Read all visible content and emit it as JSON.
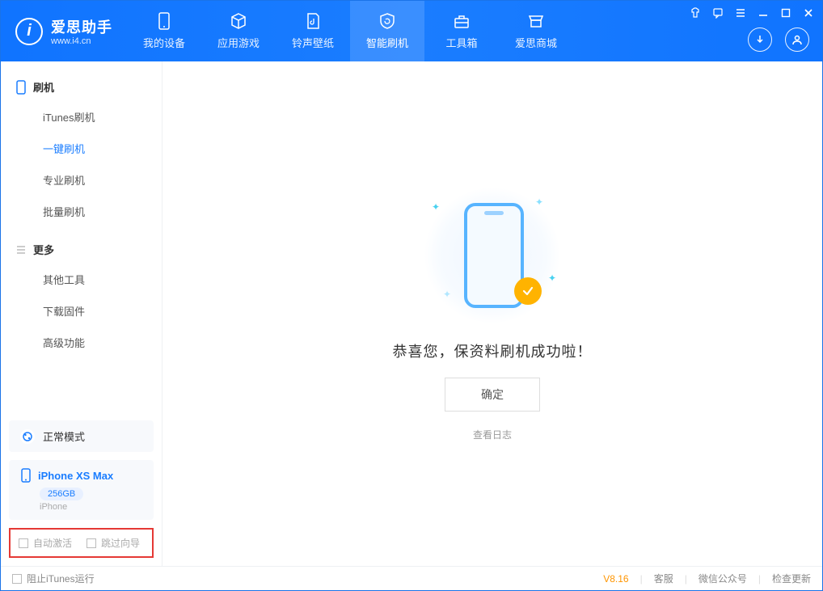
{
  "app": {
    "name": "爱思助手",
    "url": "www.i4.cn"
  },
  "nav": {
    "items": [
      {
        "label": "我的设备",
        "icon": "device"
      },
      {
        "label": "应用游戏",
        "icon": "cube"
      },
      {
        "label": "铃声壁纸",
        "icon": "music"
      },
      {
        "label": "智能刷机",
        "icon": "shield"
      },
      {
        "label": "工具箱",
        "icon": "toolbox"
      },
      {
        "label": "爱思商城",
        "icon": "store"
      }
    ]
  },
  "sidebar": {
    "group1": {
      "title": "刷机"
    },
    "group1_items": [
      {
        "label": "iTunes刷机"
      },
      {
        "label": "一键刷机"
      },
      {
        "label": "专业刷机"
      },
      {
        "label": "批量刷机"
      }
    ],
    "group2": {
      "title": "更多"
    },
    "group2_items": [
      {
        "label": "其他工具"
      },
      {
        "label": "下载固件"
      },
      {
        "label": "高级功能"
      }
    ],
    "mode": {
      "label": "正常模式"
    },
    "device": {
      "name": "iPhone XS Max",
      "capacity": "256GB",
      "type": "iPhone"
    },
    "options": {
      "auto_activate": "自动激活",
      "skip_guide": "跳过向导"
    }
  },
  "main": {
    "success_text": "恭喜您，保资料刷机成功啦！",
    "ok_label": "确定",
    "log_label": "查看日志"
  },
  "footer": {
    "block_itunes": "阻止iTunes运行",
    "version": "V8.16",
    "links": {
      "support": "客服",
      "wechat": "微信公众号",
      "update": "检查更新"
    }
  }
}
